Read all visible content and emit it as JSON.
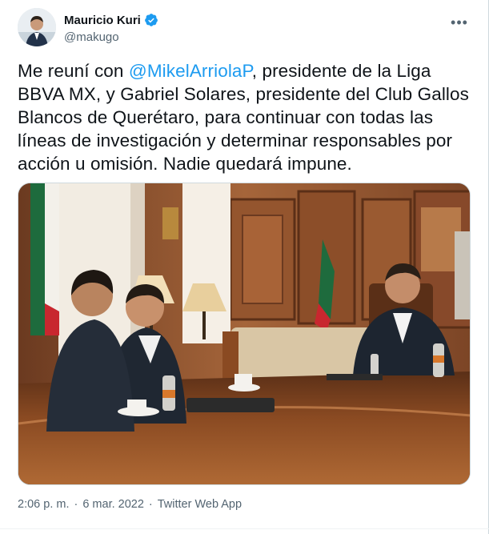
{
  "author": {
    "display_name": "Mauricio Kuri",
    "handle": "@makugo",
    "verified": true
  },
  "more_icon": "ellipsis-icon",
  "tweet": {
    "text_before": "Me reuní con ",
    "mention": "@MikelArriolaP",
    "text_after": ", presidente de la Liga BBVA MX, y Gabriel Solares, presidente del Club Gallos Blancos de Querétaro, para continuar con todas las líneas de investigación y determinar responsables por acción u omisión. Nadie quedará impune."
  },
  "media": {
    "icon": "photo",
    "colors": {
      "wood": "#8a4f2a",
      "table": "#6b3a1d",
      "curtain": "#f2ece2"
    }
  },
  "meta": {
    "time": "2:06 p. m.",
    "separator": "·",
    "date": "6 mar. 2022",
    "separator2": "·",
    "source": "Twitter Web App"
  },
  "colors": {
    "accent": "#1d9bf0",
    "muted": "#536471",
    "text": "#0f1419"
  }
}
